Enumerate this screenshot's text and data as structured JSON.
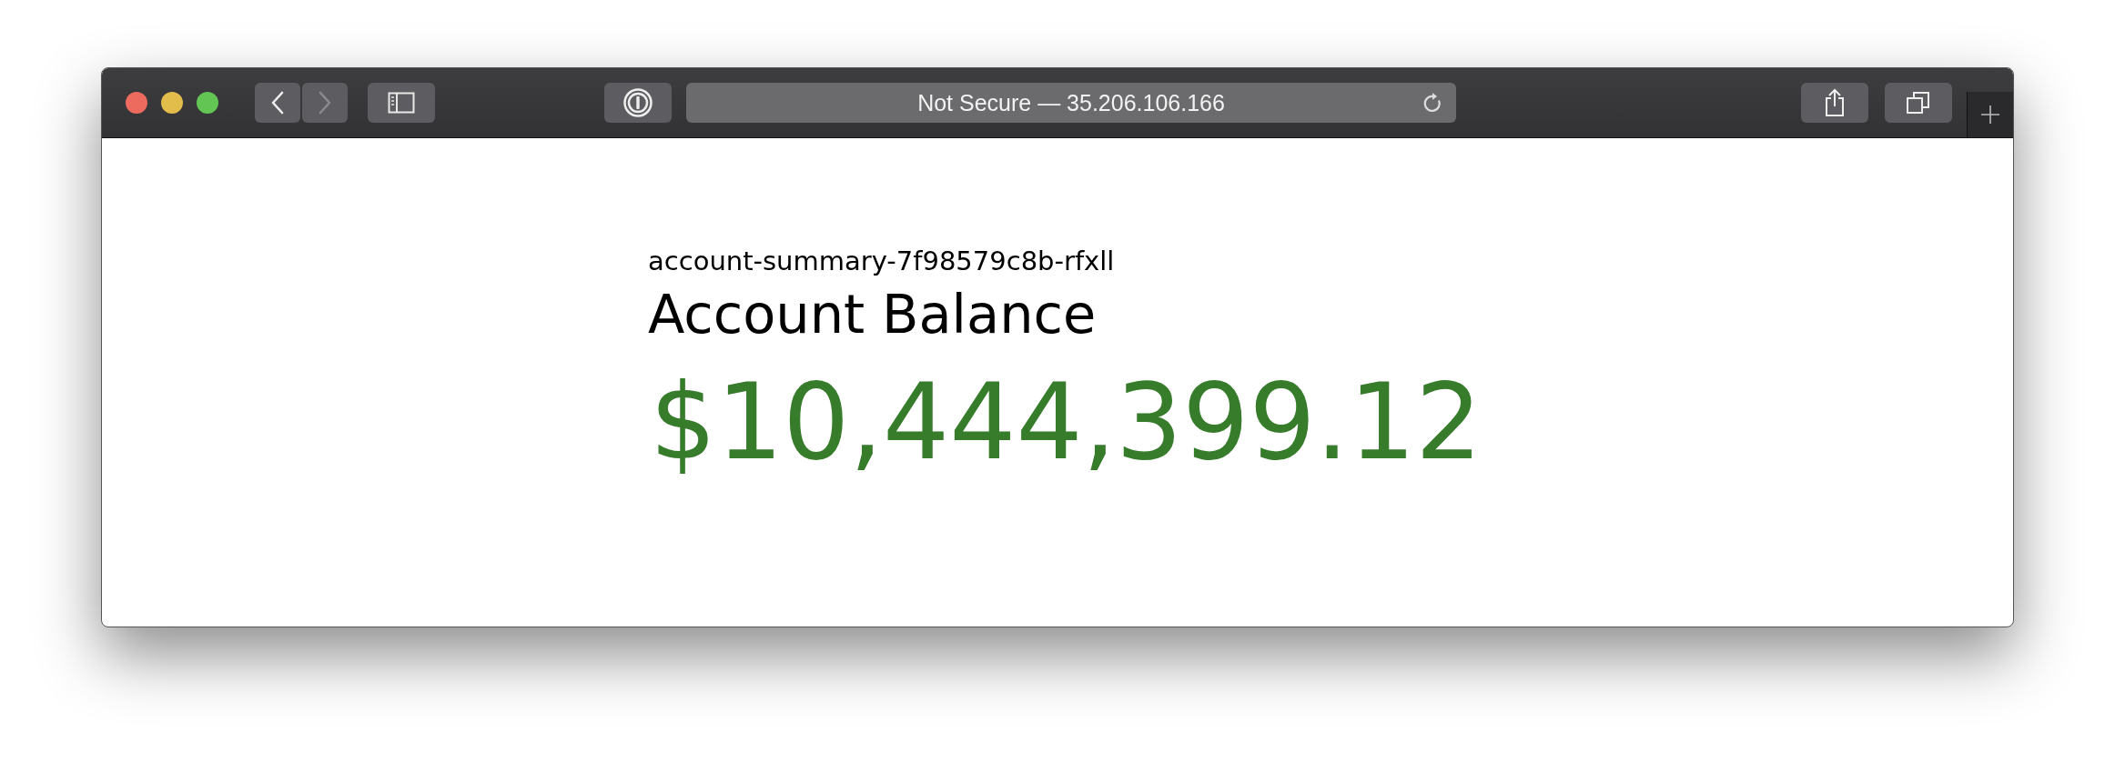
{
  "window": {
    "address": "Not Secure — 35.206.106.166"
  },
  "navigation": {
    "back": {
      "disabled": false
    },
    "forward": {
      "disabled": true
    }
  },
  "page": {
    "pod_name": "account-summary-7f98579c8b-rfxll",
    "heading": "Account Balance",
    "balance": "$10,444,399.12"
  }
}
